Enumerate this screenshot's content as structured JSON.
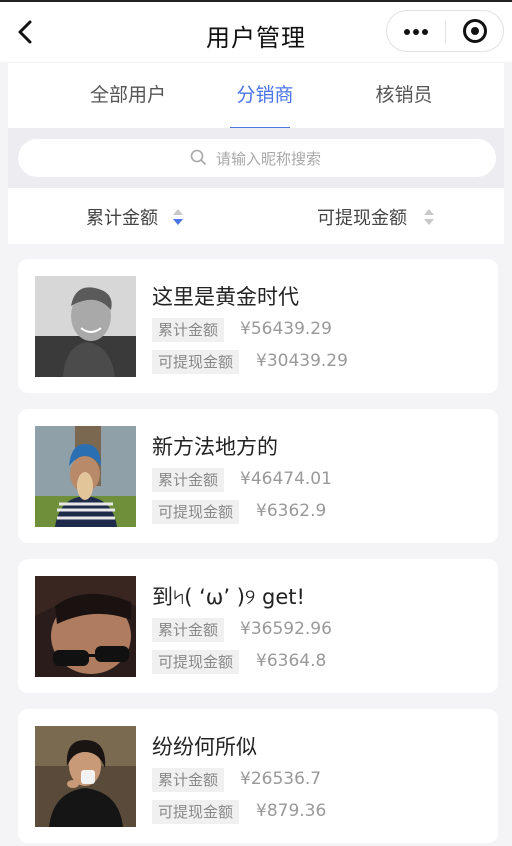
{
  "nav": {
    "title": "用户管理",
    "back_icon": "chevron-left-icon",
    "more_icon": "more-dots-icon",
    "capsule_icon": "target-circle-icon"
  },
  "tabs": [
    {
      "label": "全部用户",
      "active": false
    },
    {
      "label": "分销商",
      "active": true
    },
    {
      "label": "核销员",
      "active": false
    }
  ],
  "search": {
    "placeholder": "请输入昵称搜索",
    "icon": "search-icon"
  },
  "sort": [
    {
      "label": "累计金额",
      "icon": "sort-arrows-icon",
      "active": true
    },
    {
      "label": "可提现金额",
      "icon": "sort-arrows-icon",
      "active": false
    }
  ],
  "users": [
    {
      "name": "这里是黄金时代",
      "total_label": "累计金额",
      "total": "¥56439.29",
      "withdraw_label": "可提现金额",
      "withdraw": "¥30439.29"
    },
    {
      "name": "新方法地方的",
      "total_label": "累计金额",
      "total": "¥46474.01",
      "withdraw_label": "可提现金额",
      "withdraw": "¥6362.9"
    },
    {
      "name": "到৸( ‘ω’ )୨ get!",
      "total_label": "累计金额",
      "total": "¥36592.96",
      "withdraw_label": "可提现金额",
      "withdraw": "¥6364.8"
    },
    {
      "name": "纷纷何所似",
      "total_label": "累计金额",
      "total": "¥26536.7",
      "withdraw_label": "可提现金额",
      "withdraw": "¥879.36"
    }
  ],
  "colors": {
    "accent": "#4a74e8",
    "inactive_arrow": "#c8c8c8"
  }
}
